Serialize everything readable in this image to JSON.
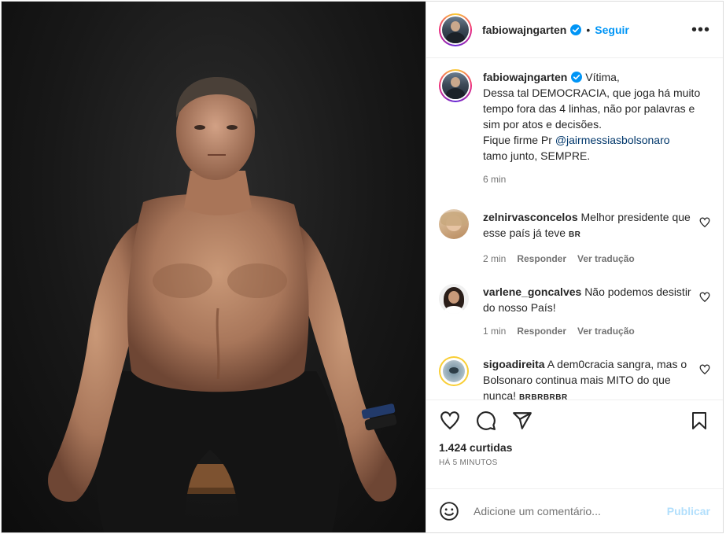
{
  "header": {
    "username": "fabiowajngarten",
    "separator": "•",
    "follow_label": "Seguir",
    "more_label": "•••"
  },
  "caption": {
    "username": "fabiowajngarten",
    "lines": [
      "Vítima,",
      "Dessa tal DEMOCRACIA, que joga há muito tempo fora das 4 linhas, não por palavras e sim por atos e decisões.",
      "Fique firme Pr"
    ],
    "mention": "@jairmessiasbolsonaro",
    "tail": "tamo junto, SEMPRE.",
    "time": "6 min"
  },
  "comments": [
    {
      "username": "zelnirvasconcelos",
      "text": "Melhor presidente que esse país já teve",
      "flag": "BR",
      "time": "2 min",
      "reply_label": "Responder",
      "translate_label": "Ver tradução"
    },
    {
      "username": "varlene_goncalves",
      "text": "Não podemos desistir do nosso País!",
      "time": "1 min",
      "reply_label": "Responder",
      "translate_label": "Ver tradução"
    },
    {
      "username": "sigoadireita",
      "text": "A dem0cracia sangra, mas o Bolsonaro continua mais MITO do que nunca!",
      "flag": "BRBRBRBR"
    }
  ],
  "actions": {
    "likes": "1.424 curtidas",
    "time_ago": "HÁ 5 MINUTOS",
    "icons": [
      "heart-icon",
      "comment-icon",
      "share-icon",
      "save-icon"
    ]
  },
  "add_comment": {
    "placeholder": "Adicione um comentário...",
    "publish_label": "Publicar"
  },
  "colors": {
    "link": "#0095f6",
    "mention": "#00376b",
    "verified": "#0095f6",
    "publish_disabled": "#b2dffc"
  }
}
